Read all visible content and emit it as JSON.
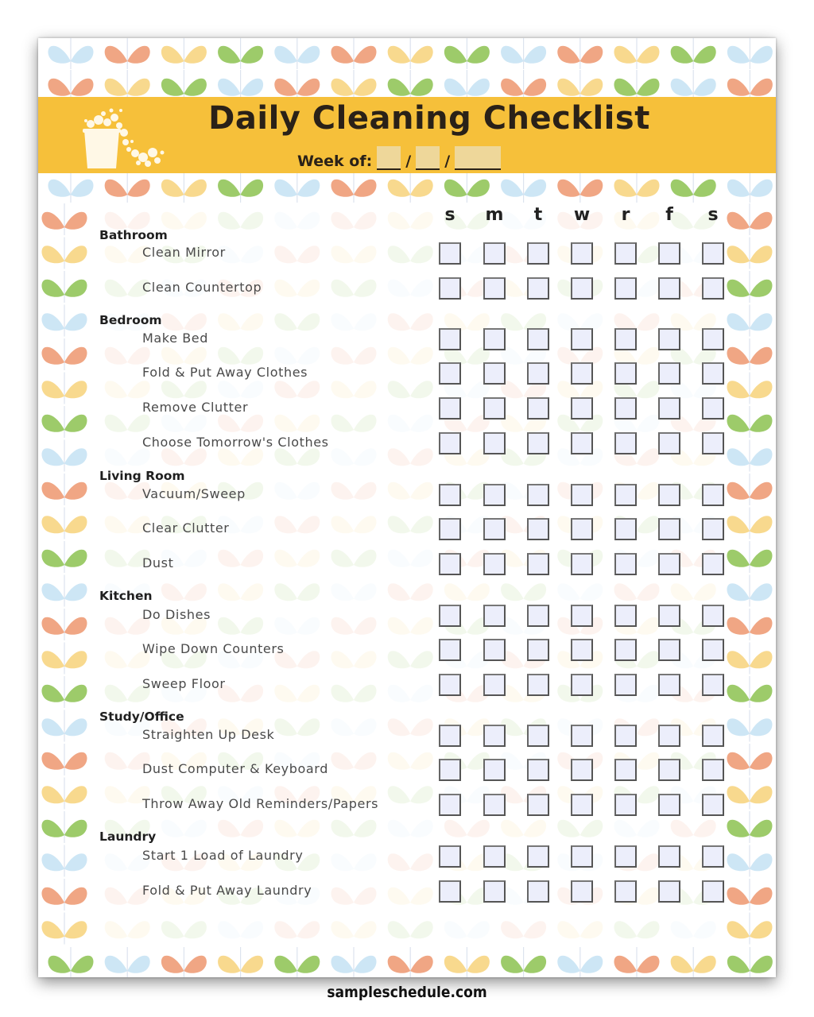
{
  "header": {
    "title": "Daily Cleaning Checklist",
    "week_label": "Week of:",
    "date_separator": "/",
    "icon": "bucket-with-bubbles-icon"
  },
  "days": [
    "s",
    "m",
    "t",
    "w",
    "r",
    "f",
    "s"
  ],
  "categories": [
    {
      "name": "Bathroom",
      "tasks": [
        "Clean Mirror",
        "Clean Countertop"
      ]
    },
    {
      "name": "Bedroom",
      "tasks": [
        "Make Bed",
        "Fold & Put Away Clothes",
        "Remove Clutter",
        "Choose Tomorrow's Clothes"
      ]
    },
    {
      "name": "Living Room",
      "tasks": [
        "Vacuum/Sweep",
        "Clear Clutter",
        "Dust"
      ]
    },
    {
      "name": "Kitchen",
      "tasks": [
        "Do Dishes",
        "Wipe Down Counters",
        "Sweep Floor"
      ]
    },
    {
      "name": "Study/Office",
      "tasks": [
        "Straighten Up Desk",
        "Dust Computer & Keyboard",
        "Throw Away Old Reminders/Papers"
      ]
    },
    {
      "name": "Laundry",
      "tasks": [
        "Start 1 Load of Laundry",
        "Fold & Put Away Laundry"
      ]
    }
  ],
  "footer": {
    "watermark": "sampleschedule.com"
  },
  "colors": {
    "banner": "#F6C03A",
    "leaf_blue": "#CDE6F5",
    "leaf_orange": "#F0A684",
    "leaf_yellow": "#F8D98E",
    "leaf_green": "#9DCB6A",
    "checkbox_fill": "#ECEEFB"
  }
}
